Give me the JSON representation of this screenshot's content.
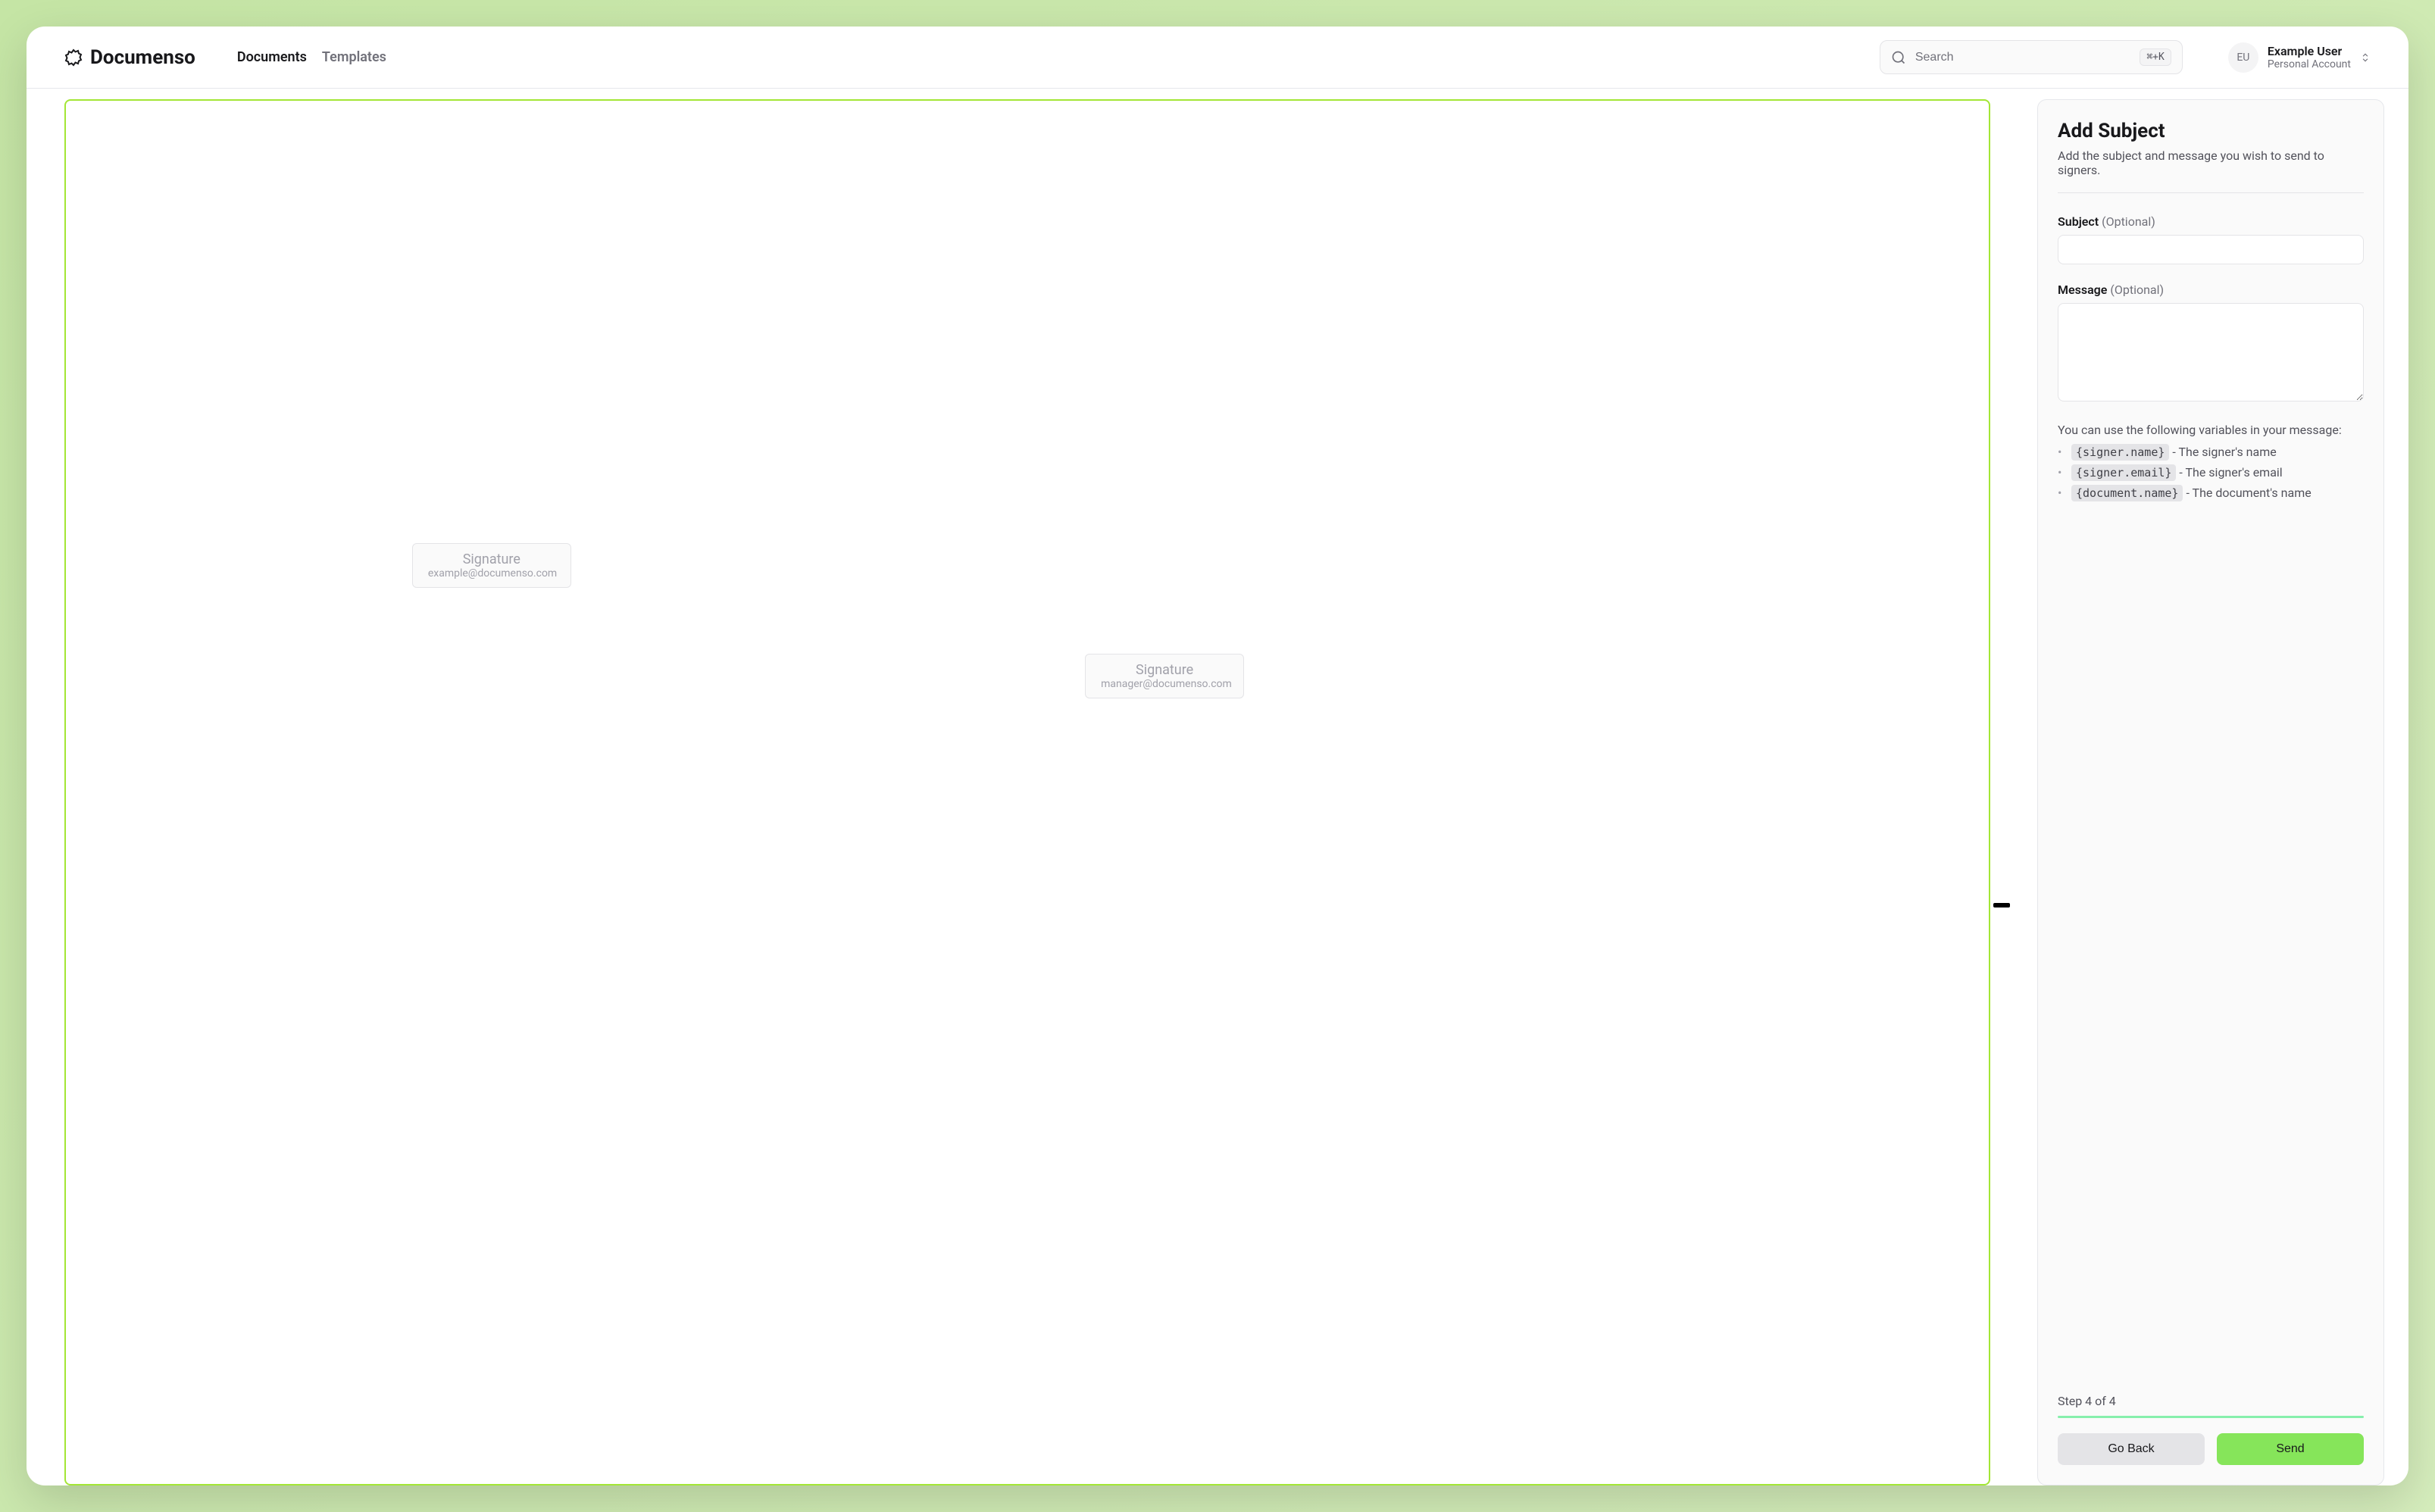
{
  "brand": {
    "name": "Documenso"
  },
  "nav": {
    "documents": "Documents",
    "templates": "Templates"
  },
  "search": {
    "placeholder": "Search",
    "shortcut": "⌘+K"
  },
  "user": {
    "initials": "EU",
    "name": "Example User",
    "account_label": "Personal Account"
  },
  "document": {
    "signature_fields": [
      {
        "label": "Signature",
        "email": "example@documenso.com"
      },
      {
        "label": "Signature",
        "email": "manager@documenso.com"
      }
    ]
  },
  "panel": {
    "title": "Add Subject",
    "subtitle": "Add the subject and message you wish to send to signers.",
    "subject_label": "Subject",
    "subject_optional": "(Optional)",
    "message_label": "Message",
    "message_optional": "(Optional)",
    "variables_intro": "You can use the following variables in your message:",
    "variables": [
      {
        "code": "{signer.name}",
        "desc": " - The signer's name"
      },
      {
        "code": "{signer.email}",
        "desc": " - The signer's email"
      },
      {
        "code": "{document.name}",
        "desc": " - The document's name"
      }
    ],
    "step_text": "Step 4 of 4",
    "go_back": "Go Back",
    "send": "Send"
  }
}
